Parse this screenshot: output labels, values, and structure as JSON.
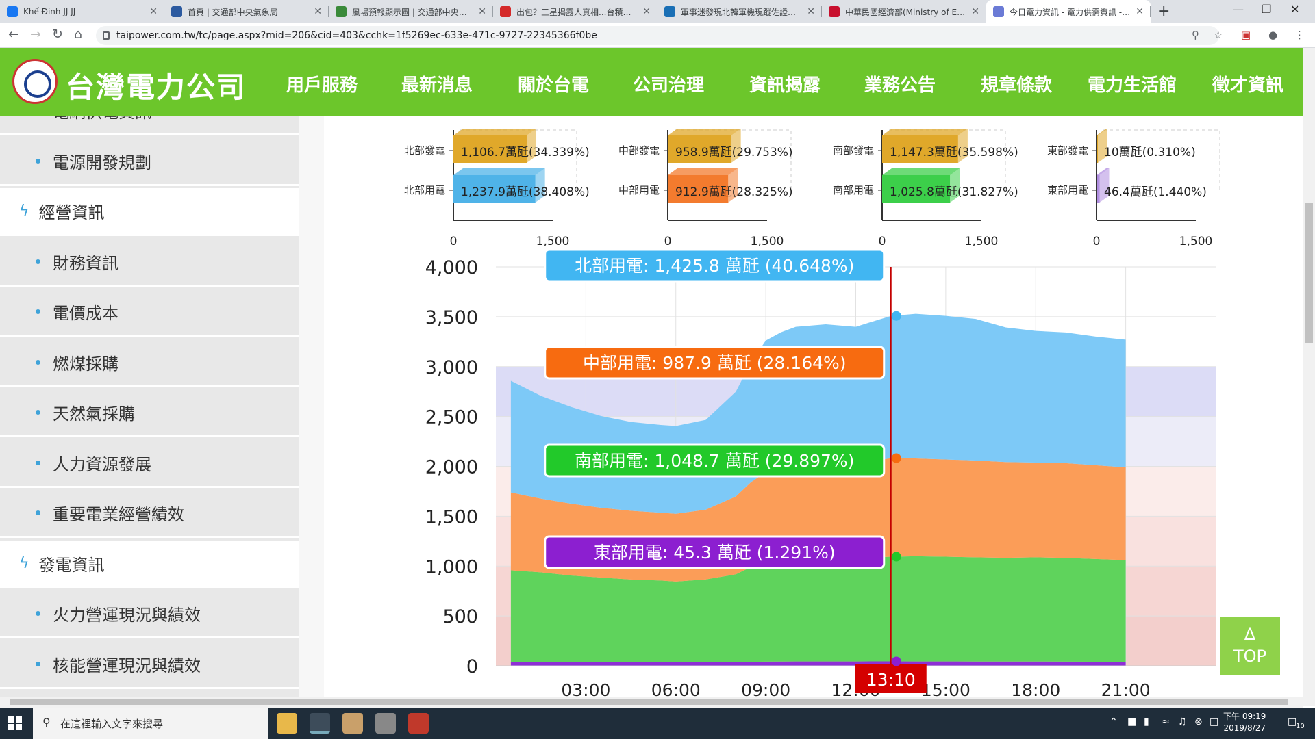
{
  "browser": {
    "tabs": [
      {
        "title": "Khế Đinh JJ JJ",
        "color": "#1877f2"
      },
      {
        "title": "首頁 | 交通部中央氣象局",
        "color": "#2c5aa0"
      },
      {
        "title": "風場預報顯示圖 | 交通部中央氣象局",
        "color": "#3a8a3a"
      },
      {
        "title": "出包？三星揭露人真相...台積電說",
        "color": "#d42a2a"
      },
      {
        "title": "軍事迷發現北韓軍機現蹤佐證外界",
        "color": "#1a6fb5"
      },
      {
        "title": "中華民國經濟部(Ministry of Econ",
        "color": "#c8102e"
      },
      {
        "title": "今日電力資訊 - 電力供需資訊 - 資",
        "color": "#6b7bd6"
      }
    ],
    "new_tab": "+",
    "url": "taipower.com.tw/tc/page.aspx?mid=206&cid=403&cchk=1f5269ec-633e-471c-9727-22345366f0be"
  },
  "site": {
    "logo_text": "台灣電力公司",
    "nav": [
      "用戶服務",
      "最新消息",
      "關於台電",
      "公司治理",
      "資訊揭露",
      "業務公告",
      "規章條款",
      "電力生活館",
      "徵才資訊"
    ]
  },
  "sidebar": {
    "items": [
      {
        "label": "電網供電資訊",
        "type": "sub"
      },
      {
        "label": "電源開發規劃",
        "type": "sub"
      },
      {
        "label": "經營資訊",
        "type": "head"
      },
      {
        "label": "財務資訊",
        "type": "sub"
      },
      {
        "label": "電價成本",
        "type": "sub"
      },
      {
        "label": "燃煤採購",
        "type": "sub"
      },
      {
        "label": "天然氣採購",
        "type": "sub"
      },
      {
        "label": "人力資源發展",
        "type": "sub"
      },
      {
        "label": "重要電業經營績效",
        "type": "sub"
      },
      {
        "label": "發電資訊",
        "type": "head"
      },
      {
        "label": "火力營運現況與績效",
        "type": "sub"
      },
      {
        "label": "核能營運現況與績效",
        "type": "sub"
      }
    ]
  },
  "chart_data": [
    {
      "type": "bar",
      "categories": [
        "北部發電",
        "北部用電"
      ],
      "values": [
        1106.7,
        1237.9
      ],
      "data_labels": [
        "1,106.7萬瓩(34.339%)",
        "1,237.9萬瓩(38.408%)"
      ],
      "colors": [
        "#e0a82a",
        "#4fb3e8"
      ],
      "xlim": [
        0,
        1500
      ],
      "ticks": [
        "0",
        "1,500"
      ]
    },
    {
      "type": "bar",
      "categories": [
        "中部發電",
        "中部用電"
      ],
      "values": [
        958.9,
        912.9
      ],
      "data_labels": [
        "958.9萬瓩(29.753%)",
        "912.9萬瓩(28.325%)"
      ],
      "colors": [
        "#e0a82a",
        "#f37b2e"
      ],
      "xlim": [
        0,
        1500
      ],
      "ticks": [
        "0",
        "1,500"
      ]
    },
    {
      "type": "bar",
      "categories": [
        "南部發電",
        "南部用電"
      ],
      "values": [
        1147.3,
        1025.8
      ],
      "data_labels": [
        "1,147.3萬瓩(35.598%)",
        "1,025.8萬瓩(31.827%)"
      ],
      "colors": [
        "#e0a82a",
        "#3ccf4a"
      ],
      "xlim": [
        0,
        1500
      ],
      "ticks": [
        "0",
        "1,500"
      ]
    },
    {
      "type": "bar",
      "categories": [
        "東部發電",
        "東部用電"
      ],
      "values": [
        10,
        46.4
      ],
      "data_labels": [
        "10萬瓩(0.310%)",
        "46.4萬瓩(1.440%)"
      ],
      "colors": [
        "#e0a82a",
        "#b08ee0"
      ],
      "xlim": [
        0,
        1500
      ],
      "ticks": [
        "0",
        "1,500"
      ]
    },
    {
      "type": "area",
      "stacked": true,
      "x_hours": [
        0.5,
        1.5,
        2.5,
        3.5,
        4.5,
        5.5,
        6.0,
        7.0,
        8.0,
        8.5,
        9.0,
        9.5,
        10.0,
        11.0,
        12.0,
        13.17,
        14.0,
        15.0,
        16.0,
        17.0,
        18.0,
        19.0,
        20.0,
        21.0
      ],
      "series": [
        {
          "name": "東部用電",
          "color": "#8e2fd6",
          "values": [
            38,
            37,
            36,
            35,
            35,
            35,
            35,
            36,
            38,
            40,
            42,
            43,
            44,
            44,
            44,
            45,
            44,
            44,
            43,
            43,
            43,
            42,
            41,
            40
          ]
        },
        {
          "name": "南部用電",
          "color": "#5fd35c",
          "values": [
            920,
            900,
            870,
            850,
            830,
            820,
            810,
            830,
            880,
            950,
            1000,
            1020,
            1035,
            1040,
            1035,
            1049,
            1055,
            1050,
            1045,
            1040,
            1045,
            1040,
            1030,
            1020
          ]
        },
        {
          "name": "中部用電",
          "color": "#fb9d58",
          "values": [
            780,
            740,
            720,
            700,
            690,
            680,
            680,
            700,
            780,
            850,
            900,
            920,
            940,
            950,
            940,
            988,
            980,
            975,
            970,
            960,
            950,
            950,
            940,
            930
          ]
        },
        {
          "name": "北部用電",
          "color": "#7dc9f7",
          "values": [
            1120,
            1030,
            970,
            920,
            890,
            880,
            880,
            900,
            1050,
            1200,
            1320,
            1360,
            1380,
            1390,
            1380,
            1426,
            1450,
            1440,
            1420,
            1350,
            1320,
            1310,
            1290,
            1280
          ]
        }
      ],
      "x_ticks": [
        "03:00",
        "06:00",
        "09:00",
        "12:00",
        "15:00",
        "18:00",
        "21:00"
      ],
      "y_ticks": [
        "0",
        "500",
        "1,000",
        "1,500",
        "2,000",
        "2,500",
        "3,000",
        "3,500",
        "4,000"
      ],
      "ylim": [
        0,
        4000
      ],
      "xlim": [
        0,
        24
      ],
      "crosshair_label": "13:10",
      "tooltips": [
        {
          "series": "北部用電",
          "text": "北部用電: 1,425.8 萬瓩 (40.648%)",
          "color": "#41b6f2"
        },
        {
          "series": "中部用電",
          "text": "中部用電: 987.9 萬瓩 (28.164%)",
          "color": "#f76b10"
        },
        {
          "series": "南部用電",
          "text": "南部用電: 1,048.7 萬瓩 (29.897%)",
          "color": "#22c92a"
        },
        {
          "series": "東部用電",
          "text": "東部用電: 45.3 萬瓩 (1.291%)",
          "color": "#8c1fd0"
        }
      ]
    }
  ],
  "top_button": {
    "arrow": "Δ",
    "label": "TOP"
  },
  "taskbar": {
    "search_placeholder": "在這裡輸入文字來搜尋",
    "time": "下午 09:19",
    "date": "2019/8/27",
    "notification_count": "10"
  }
}
